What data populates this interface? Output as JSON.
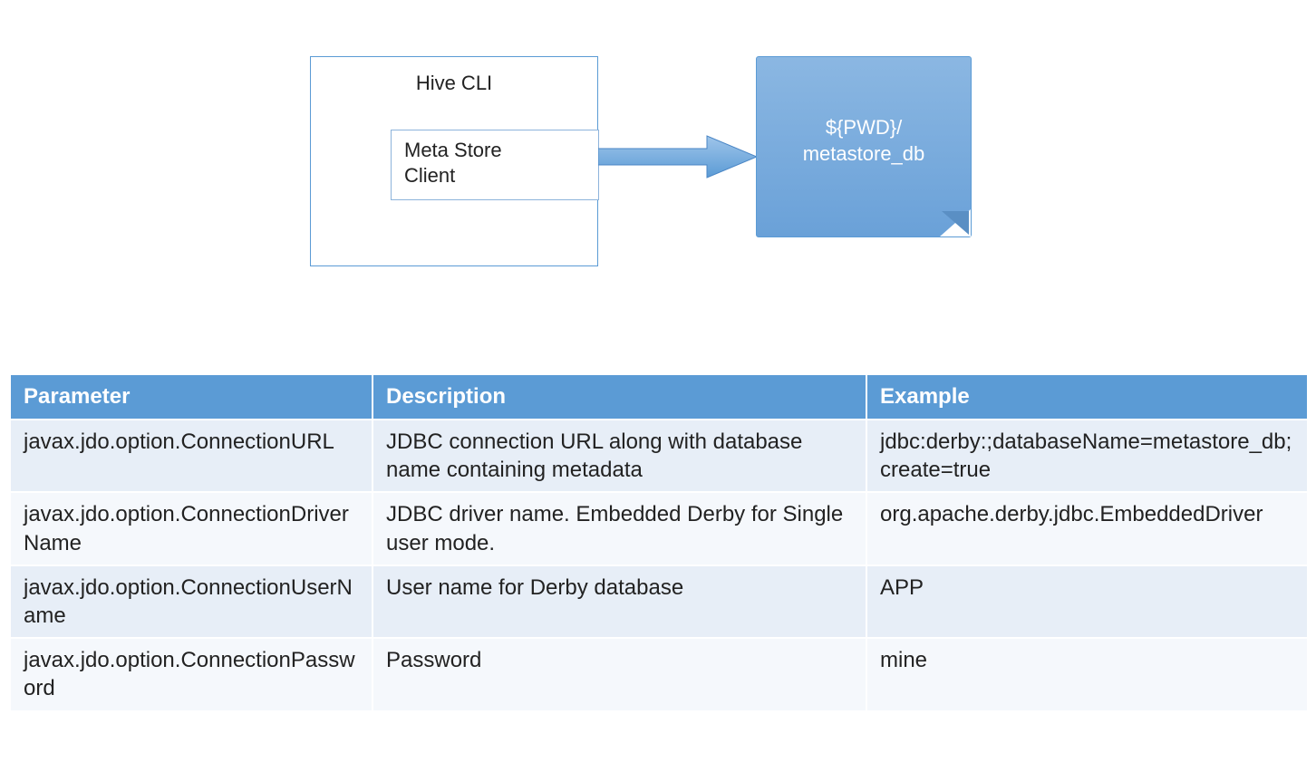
{
  "diagram": {
    "hive_title": "Hive CLI",
    "meta_client_line1": "Meta Store",
    "meta_client_line2": "Client",
    "db_line1": "${PWD}/",
    "db_line2": "metastore_db"
  },
  "table": {
    "headers": {
      "param": "Parameter",
      "desc": "Description",
      "example": "Example"
    },
    "rows": [
      {
        "param": "javax.jdo.option.ConnectionURL",
        "desc": "JDBC connection URL along with database name containing metadata",
        "example": "jdbc:derby:;databaseName=metastore_db;create=true"
      },
      {
        "param": "javax.jdo.option.ConnectionDriverName",
        "desc": "JDBC driver name. Embedded Derby for Single user mode.",
        "example": "org.apache.derby.jdbc.EmbeddedDriver"
      },
      {
        "param": "javax.jdo.option.ConnectionUserName",
        "desc": "User name for Derby database",
        "example": "APP"
      },
      {
        "param": "javax.jdo.option.ConnectionPassword",
        "desc": "Password",
        "example": "mine"
      }
    ]
  },
  "colors": {
    "header_bg": "#5b9bd5",
    "row_odd": "#e7eef7",
    "row_even": "#f5f8fc",
    "note_bg_top": "#8bb7e2",
    "note_bg_bottom": "#6aa1d8"
  }
}
